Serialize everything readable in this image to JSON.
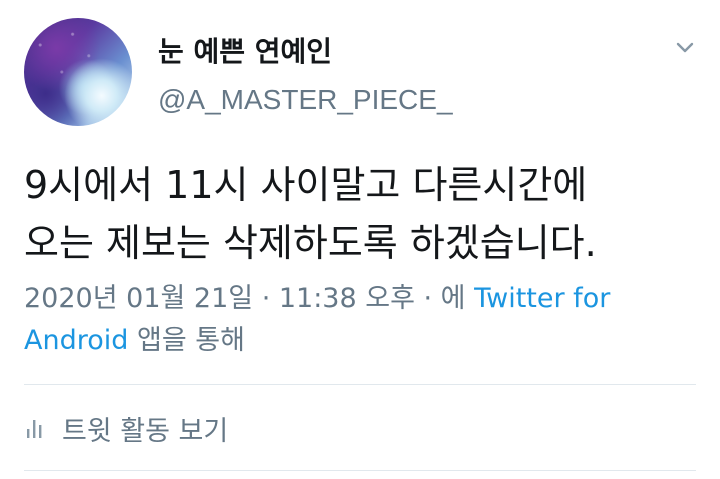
{
  "tweet": {
    "display_name": "눈 예쁜 연예인",
    "handle": "@A_MASTER_PIECE_",
    "text": "9시에서 11시 사이말고 다른시간에\n오는 제보는 삭제하도록 하겠습니다.",
    "timestamp": "2020년 01월 21일 · 11:38 오후 · 에 ",
    "source_link": "Twitter for Android",
    "source_suffix": " 앱을 통해",
    "activity_label": "트윗 활동 보기"
  },
  "icons": {
    "menu": "chevron-down-icon",
    "activity": "bar-chart-icon",
    "avatar": "profile-avatar"
  },
  "colors": {
    "name": "#14171a",
    "secondary": "#657786",
    "link": "#1b95e0",
    "divider": "#e1e8ed"
  }
}
